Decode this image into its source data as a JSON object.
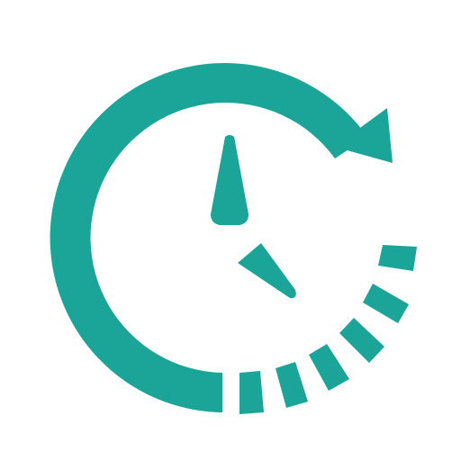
{
  "icon": {
    "name": "clock-history-icon",
    "color": "#1aa598",
    "background": "#ffffff"
  }
}
